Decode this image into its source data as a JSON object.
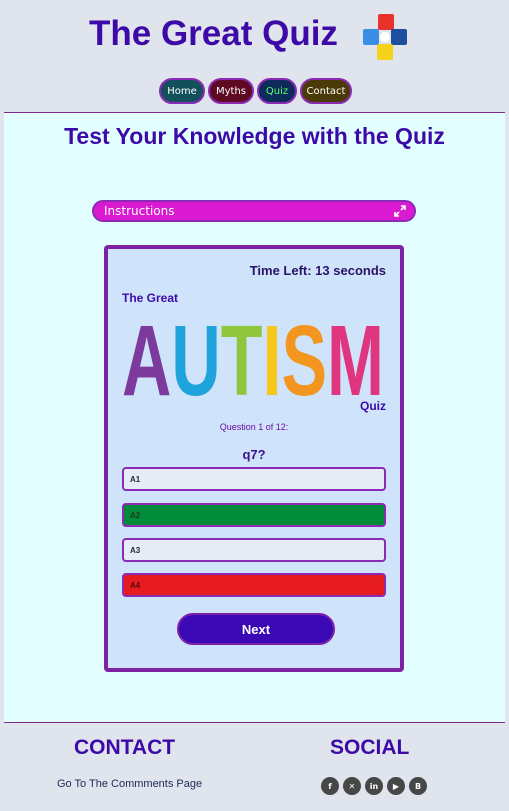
{
  "header": {
    "title": "The Great Quiz",
    "nav": [
      {
        "label": "Home"
      },
      {
        "label": "Myths"
      },
      {
        "label": "Quiz"
      },
      {
        "label": "Contact"
      }
    ]
  },
  "main": {
    "heading": "Test Your Knowledge with the Quiz",
    "instructions_label": "Instructions"
  },
  "quiz": {
    "timer": "Time Left: 13 seconds",
    "brand_top": "The Great",
    "brand_word": "AUTISM",
    "brand_bottom": "Quiz",
    "question_count": "Question 1 of 12:",
    "question": "q7?",
    "answers": [
      {
        "label": "A1",
        "state": "default"
      },
      {
        "label": "A2",
        "state": "correct"
      },
      {
        "label": "A3",
        "state": "default"
      },
      {
        "label": "A4",
        "state": "wrong"
      }
    ],
    "next_label": "Next"
  },
  "footer": {
    "contact_heading": "CONTACT",
    "social_heading": "SOCIAL",
    "comments_link": "Go To The Commments Page",
    "social_icons": [
      "facebook-icon",
      "x-icon",
      "linkedin-icon",
      "youtube-icon",
      "blogger-icon"
    ]
  },
  "colors": {
    "accent": "#3d0aa8",
    "border": "#8b2bb5",
    "correct": "#008c3a",
    "wrong": "#e51b1f"
  }
}
